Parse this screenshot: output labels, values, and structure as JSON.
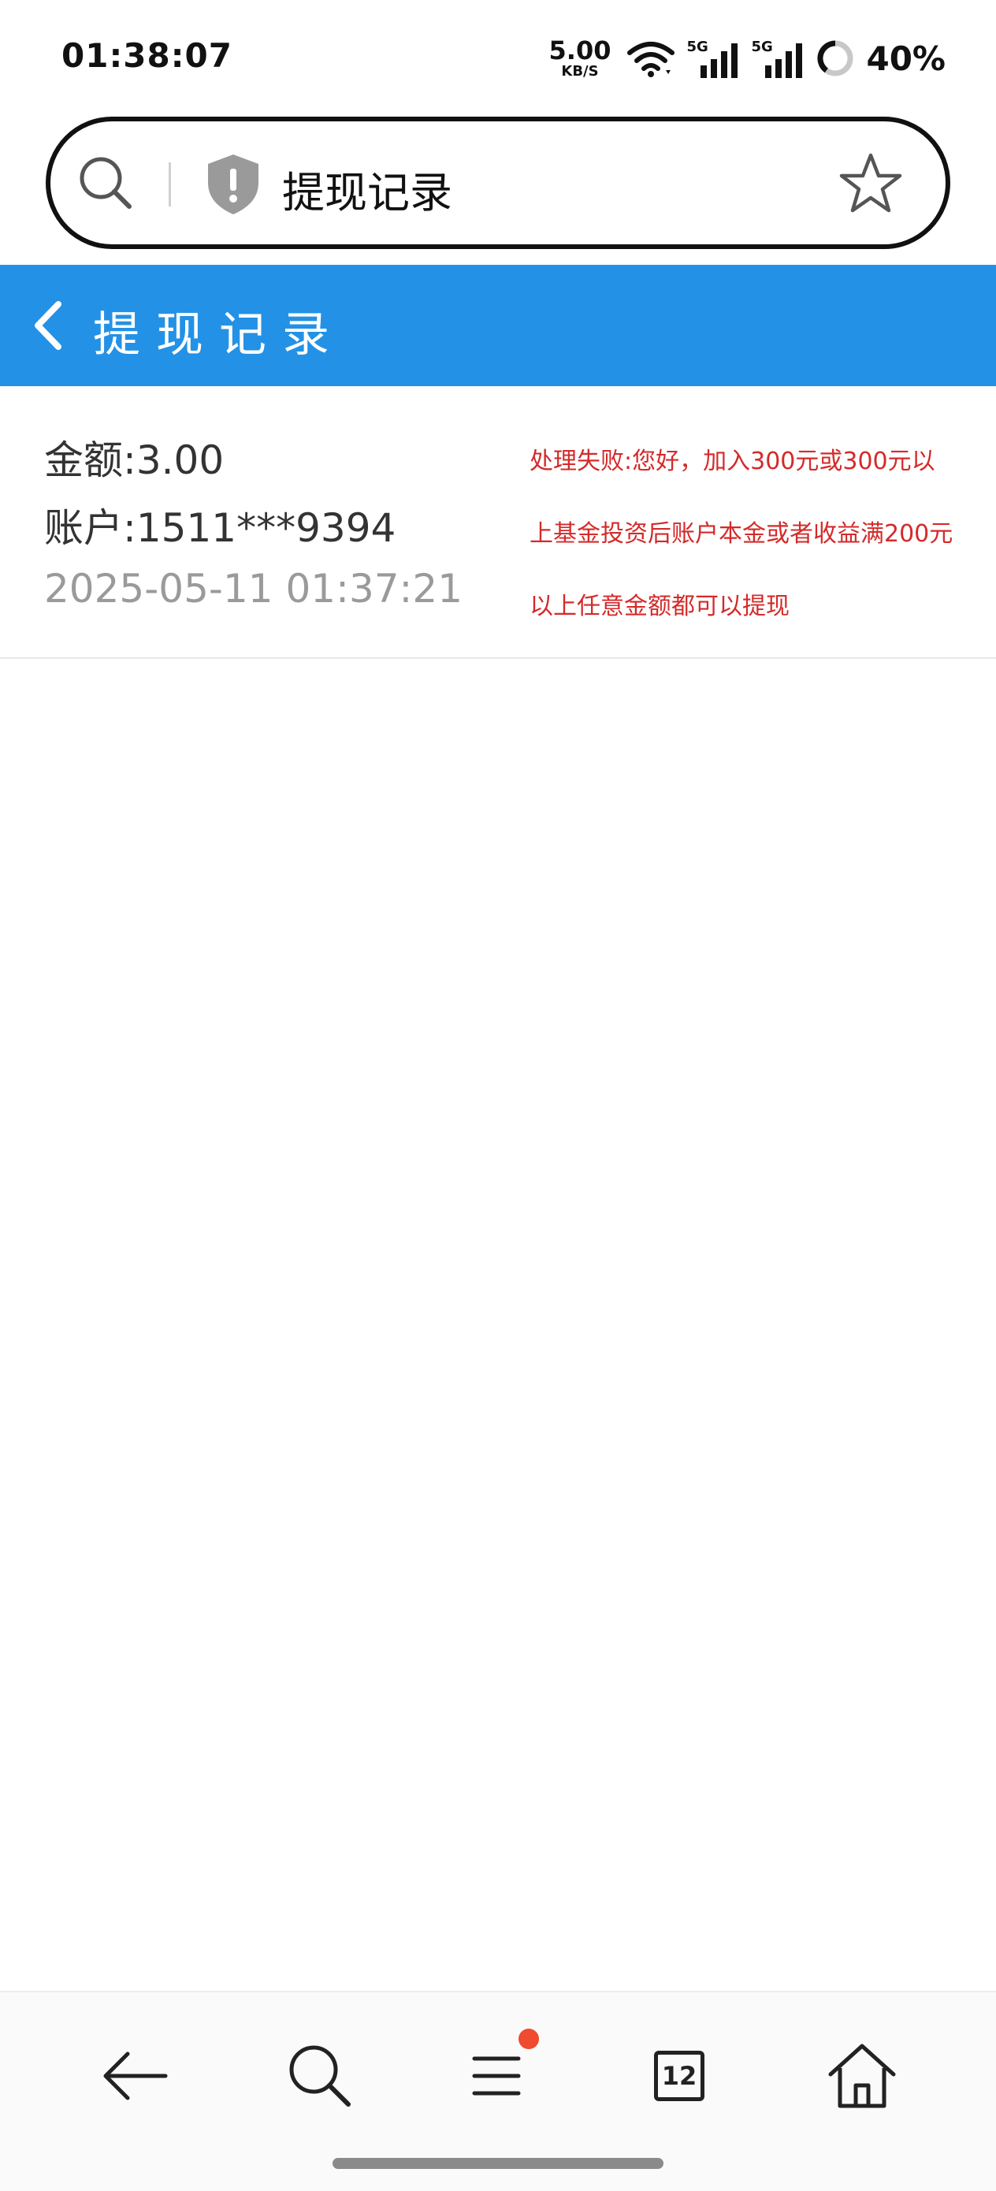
{
  "status_bar": {
    "time": "01:38:07",
    "net_speed_value": "5.00",
    "net_speed_unit": "KB/S",
    "sim1_label": "5G",
    "sim2_label": "5G",
    "battery_percent": "40%"
  },
  "address_bar": {
    "url_text": "提现记录"
  },
  "header": {
    "title": "提现记录"
  },
  "records": [
    {
      "amount": "金额:3.00",
      "account": "账户:1511***9394",
      "time": "2025-05-11 01:37:21",
      "status_message": "处理失败:您好，加入300元或300元以上基金投资后账户本金或者收益满200元以上任意金额都可以提现"
    }
  ],
  "bottom_nav": {
    "tab_count": "12"
  },
  "colors": {
    "header_bg": "#2392e6",
    "error_text": "#d42a2a",
    "badge": "#f04a2f"
  },
  "icons": {
    "address_left": "search-icon",
    "address_security": "shield-warning-icon",
    "address_right": "star-icon",
    "header_back": "chevron-left-icon",
    "nav": [
      "arrow-left-icon",
      "search-icon",
      "menu-icon",
      "tabs-icon",
      "home-icon"
    ]
  }
}
